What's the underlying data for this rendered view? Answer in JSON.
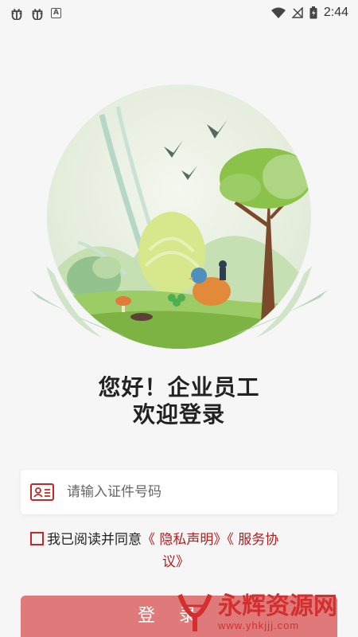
{
  "status_bar": {
    "time": "2:44",
    "icons": [
      "bug-icon",
      "bug-icon",
      "a-notification-icon",
      "wifi-icon",
      "no-signal-icon",
      "battery-charging-icon"
    ],
    "notification_letter": "A"
  },
  "illustration": {
    "description_icon": "landscape-illustration"
  },
  "greeting": {
    "line1": "您好！企业员工",
    "line2": "欢迎登录"
  },
  "id_input": {
    "placeholder": "请输入证件号码",
    "value": "",
    "icon": "id-card-icon"
  },
  "agreement": {
    "checked": false,
    "text_prefix": "我已阅读并同意",
    "privacy_link": "《 隐私声明》",
    "service_link_part1": "《 服务协",
    "service_link_part2": "议》"
  },
  "login_button": {
    "label": "登录"
  },
  "watermark": {
    "main": "永辉资源网",
    "url": "www.yhkjjj.com"
  },
  "colors": {
    "accent": "#c62828",
    "button": "#e07a7a",
    "background": "#f6f6f6"
  }
}
